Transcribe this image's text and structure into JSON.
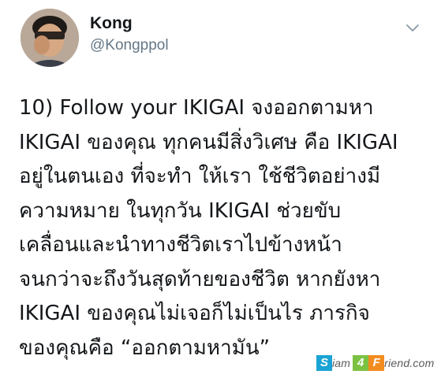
{
  "author": {
    "display_name": "Kong",
    "handle": "@Kongppol"
  },
  "menu_icon": "chevron-down-icon",
  "tweet_lines": [
    "10) Follow your IKIGAI จงออกตามหา",
    "IKIGAI ของคุณ ทุกคนมีสิ่งวิเศษ คือ IKIGAI",
    "อยู่ในตนเอง ที่จะทำ ให้เรา ใช้ชีวิตอย่างมี",
    "ความหมาย ในทุกวัน IKIGAI ช่วยขับ",
    "เคลื่อนและนำทางชีวิตเราไปข้างหน้า",
    "จนกว่าจะถึงวันสุดท้ายของชีวิต หากยังหา",
    "IKIGAI ของคุณไม่เจอก็ไม่เป็นไร ภารกิจ",
    "ของคุณคือ “ออกตามหามัน”"
  ],
  "watermark": {
    "s": "S",
    "iam": "iam",
    "four": "4",
    "f": "F",
    "riend": "riend.com"
  },
  "colors": {
    "text": "#14171a",
    "secondary": "#657786",
    "watermark_blue": "#1aa3d4",
    "watermark_green": "#7cc242",
    "watermark_orange": "#f28c1f"
  }
}
